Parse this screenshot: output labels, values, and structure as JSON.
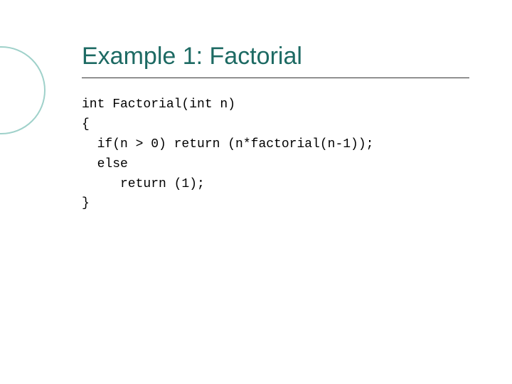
{
  "slide": {
    "title": "Example 1: Factorial",
    "code": "int Factorial(int n)\n{\n  if(n > 0) return (n*factorial(n-1));\n  else\n     return (1);\n}"
  }
}
